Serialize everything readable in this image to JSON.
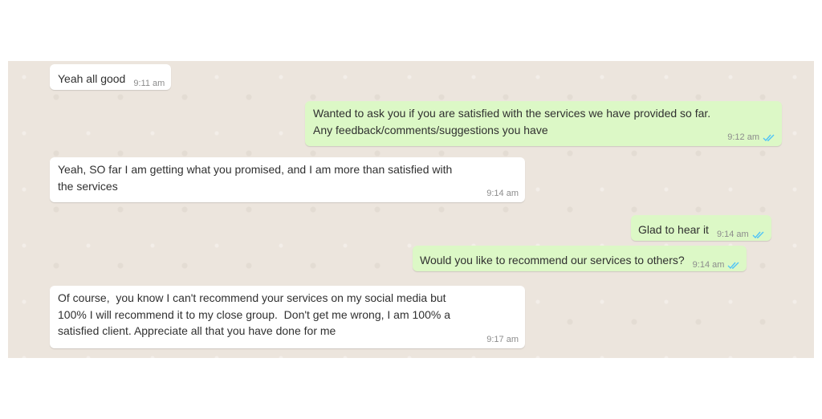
{
  "colors": {
    "chat_background": "#ece5dd",
    "incoming_bubble": "#ffffff",
    "outgoing_bubble": "#dcf8c6",
    "read_ticks": "#4fc3f7",
    "timestamp": "#8c8c8c"
  },
  "messages": [
    {
      "direction": "incoming",
      "text": "Yeah all good",
      "time": "9:11 am"
    },
    {
      "direction": "outgoing",
      "text": "Wanted to ask you if you are satisfied with the services we have provided so far.\nAny feedback/comments/suggestions you have",
      "time": "9:12 am",
      "status_icon": "double-check-icon"
    },
    {
      "direction": "incoming",
      "text": "Yeah, SO far I am getting what you promised, and I am more than satisfied with\nthe services",
      "time": "9:14 am"
    },
    {
      "direction": "outgoing",
      "text": "Glad to hear it",
      "time": "9:14 am",
      "status_icon": "double-check-icon"
    },
    {
      "direction": "outgoing",
      "text": "Would you like to recommend our services to others?",
      "time": "9:14 am",
      "status_icon": "double-check-icon"
    },
    {
      "direction": "incoming",
      "text": "Of course,  you know I can't recommend your services on my social media but\n100% I will recommend it to my close group.  Don't get me wrong, I am 100% a\nsatisfied client. Appreciate all that you have done for me",
      "time": "9:17 am"
    }
  ]
}
